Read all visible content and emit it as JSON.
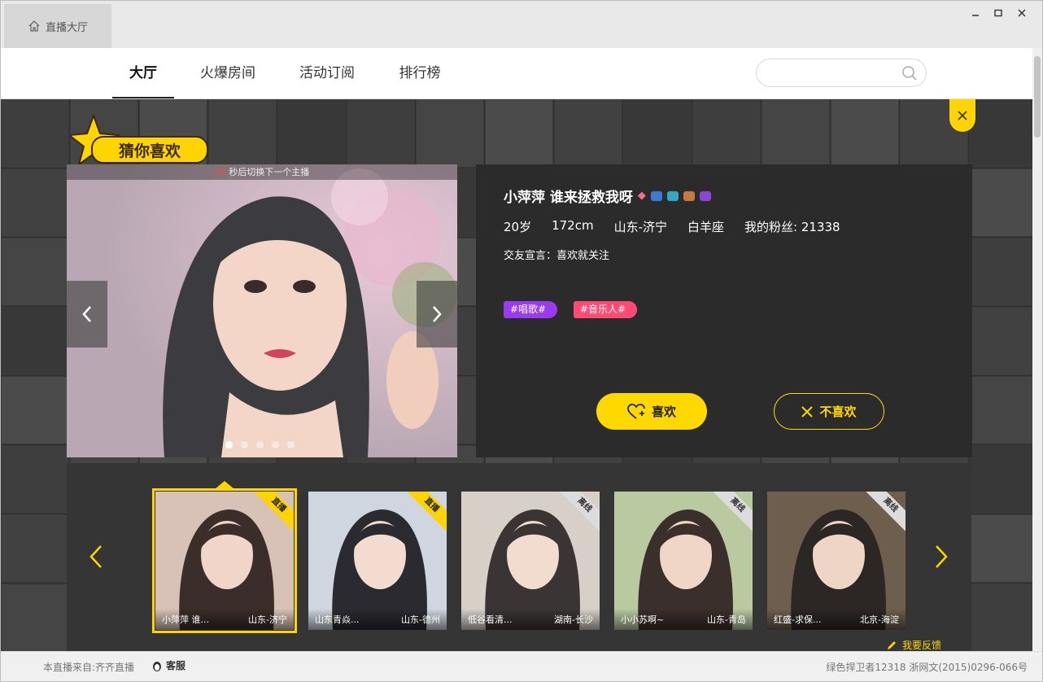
{
  "titlebar": {
    "tab_label": "直播大厅"
  },
  "nav": {
    "items": [
      "大厅",
      "火爆房间",
      "活动订阅",
      "排行榜"
    ],
    "active": "大厅",
    "search_placeholder": ""
  },
  "guess": {
    "badge_text": "猜你喜欢"
  },
  "featured": {
    "countdown_num": "28",
    "countdown_text": "秒后切换下一个主播",
    "name": "小萍萍 谁来拯救我呀",
    "age": "20岁",
    "height": "172cm",
    "location": "山东-济宁",
    "zodiac": "白羊座",
    "fans": "我的粉丝: 21338",
    "declaration": "交友宣言：喜欢就关注",
    "tags": [
      "#唱歌#",
      "#音乐人#"
    ],
    "like_label": "喜欢",
    "dislike_label": "不喜欢"
  },
  "thumbs": [
    {
      "name": "小萍萍 谁...",
      "location": "山东-济宁",
      "status": "直播"
    },
    {
      "name": "山东青焱...",
      "location": "山东-德州",
      "status": "直播"
    },
    {
      "name": "低谷看清...",
      "location": "湖南-长沙",
      "status": "离线"
    },
    {
      "name": "小小苏啊~",
      "location": "山东-青岛",
      "status": "离线"
    },
    {
      "name": "红盛-求保...",
      "location": "北京-海淀",
      "status": "离线"
    }
  ],
  "feedback_label": "我要反馈",
  "footer": {
    "source": "本直播来自:齐齐直播",
    "service": "客服",
    "license": "绿色捍卫者12318   浙网文(2015)0296-066号"
  },
  "colors": {
    "accent": "#ffd400",
    "tag1": "#9b3bf0",
    "tag2": "#ff4b74"
  }
}
